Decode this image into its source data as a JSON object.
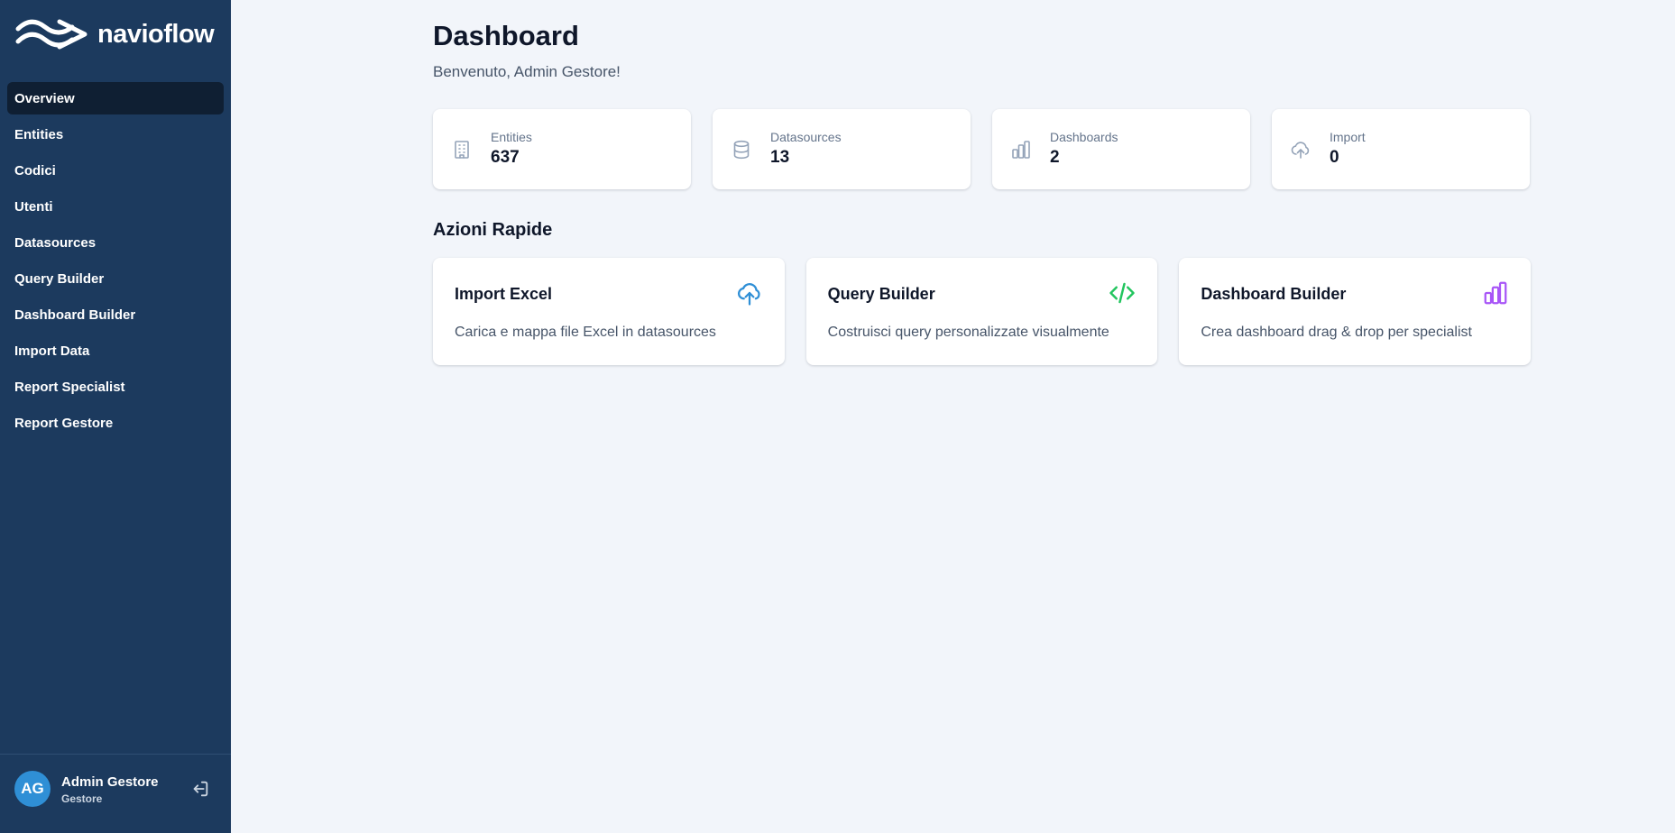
{
  "brand": {
    "name": "navioflow"
  },
  "sidebar": {
    "items": [
      {
        "label": "Overview",
        "active": true
      },
      {
        "label": "Entities"
      },
      {
        "label": "Codici"
      },
      {
        "label": "Utenti"
      },
      {
        "label": "Datasources"
      },
      {
        "label": "Query Builder"
      },
      {
        "label": "Dashboard Builder"
      },
      {
        "label": "Import Data"
      },
      {
        "label": "Report Specialist"
      },
      {
        "label": "Report Gestore"
      }
    ]
  },
  "user": {
    "initials": "AG",
    "name": "Admin Gestore",
    "role": "Gestore"
  },
  "header": {
    "title": "Dashboard",
    "subtitle": "Benvenuto, Admin Gestore!"
  },
  "stats": [
    {
      "label": "Entities",
      "value": "637",
      "icon": "building-icon"
    },
    {
      "label": "Datasources",
      "value": "13",
      "icon": "database-icon"
    },
    {
      "label": "Dashboards",
      "value": "2",
      "icon": "bar-chart-icon"
    },
    {
      "label": "Import",
      "value": "0",
      "icon": "cloud-upload-icon"
    }
  ],
  "quick_actions": {
    "title": "Azioni Rapide",
    "items": [
      {
        "title": "Import Excel",
        "description": "Carica e mappa file Excel in datasources",
        "icon": "cloud-upload-icon",
        "color": "#2f8fd6"
      },
      {
        "title": "Query Builder",
        "description": "Costruisci query personalizzate visualmente",
        "icon": "code-icon",
        "color": "#22c55e"
      },
      {
        "title": "Dashboard Builder",
        "description": "Crea dashboard drag & drop per specialist",
        "icon": "bar-chart-icon",
        "color": "#a855f7"
      }
    ]
  },
  "colors": {
    "sidebar_bg": "#1c3a5e",
    "active_item_bg": "#0f1f33",
    "page_bg": "#f2f5fa",
    "avatar_bg": "#2f8fd6"
  }
}
